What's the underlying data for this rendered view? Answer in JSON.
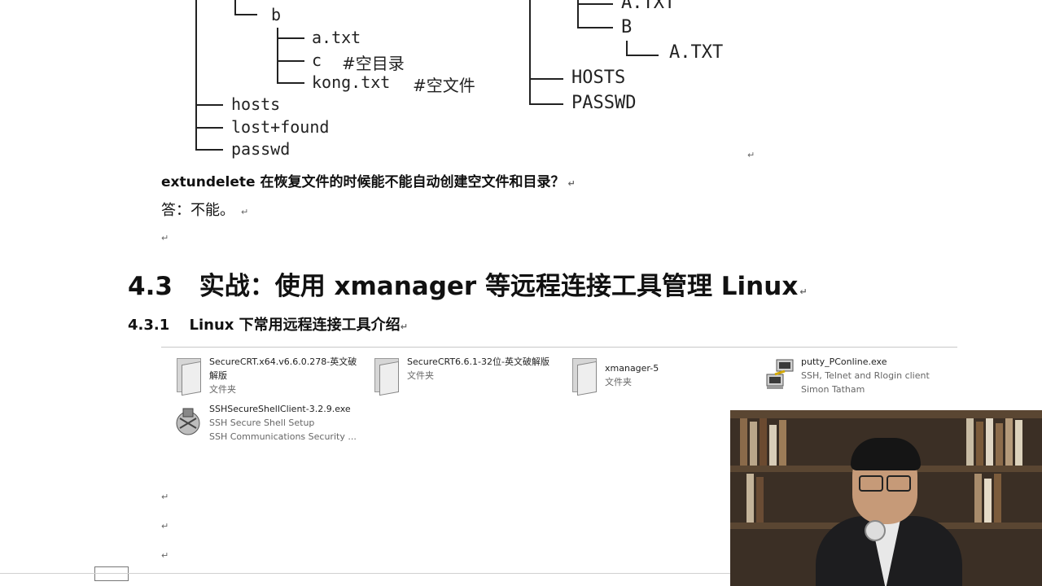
{
  "tree_left": {
    "b_label": "b",
    "b_children": [
      "a.txt",
      "c",
      "kong.txt"
    ],
    "c_comment": "#空目录",
    "kong_comment": "#空文件",
    "root_items": [
      "hosts",
      "lost+found",
      "passwd"
    ]
  },
  "tree_right": {
    "top_partial": "A.TXT",
    "b_label": "B",
    "b_child": "A.TXT",
    "root_items": [
      "HOSTS",
      "PASSWD"
    ]
  },
  "question": "extundelete 在恢复文件的时候能不能自动创建空文件和目录？",
  "answer": "答：不能。",
  "section_43": {
    "number": "4.3",
    "title": "实战：使用 xmanager 等远程连接工具管理 Linux"
  },
  "section_431": {
    "number": "4.3.1",
    "title": "Linux 下常用远程连接工具介绍"
  },
  "files": [
    {
      "name": "SecureCRT.x64.v6.6.0.278-英文破",
      "name2": "解版",
      "type": "文件夹",
      "icon": "folder-icon"
    },
    {
      "name": "SecureCRT6.6.1-32位-英文破解版",
      "name2": "",
      "type": "文件夹",
      "icon": "folder-icon"
    },
    {
      "name": "xmanager-5",
      "name2": "",
      "type": "文件夹",
      "icon": "folder-icon"
    },
    {
      "name": "putty_PConline.exe",
      "name2": "SSH, Telnet and Rlogin client",
      "type": "Simon Tatham",
      "icon": "putty-icon"
    },
    {
      "name": "SSHSecureShellClient-3.2.9.exe",
      "name2": "SSH Secure Shell Setup",
      "type": "SSH Communications Security ...",
      "icon": "ssh-installer-icon"
    }
  ],
  "paragraph_mark": "↵"
}
